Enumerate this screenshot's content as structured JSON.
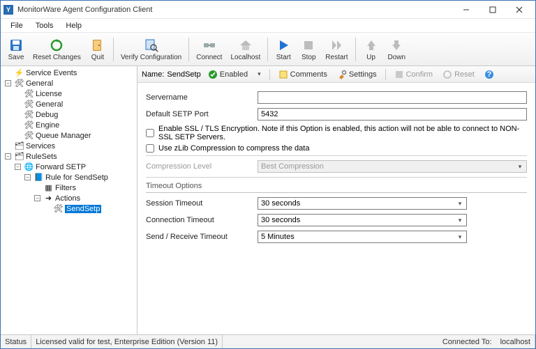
{
  "window": {
    "title": "MonitorWare Agent Configuration Client"
  },
  "menu": {
    "file": "File",
    "tools": "Tools",
    "help": "Help"
  },
  "toolbar": {
    "save": "Save",
    "reset": "Reset Changes",
    "quit": "Quit",
    "verify": "Verify Configuration",
    "connect": "Connect",
    "localhost": "Localhost",
    "start": "Start",
    "stop": "Stop",
    "restart": "Restart",
    "up": "Up",
    "down": "Down"
  },
  "tree": {
    "service_events": "Service Events",
    "general": "General",
    "license": "License",
    "general2": "General",
    "debug": "Debug",
    "engine": "Engine",
    "queue_manager": "Queue Manager",
    "services": "Services",
    "rulesets": "RuleSets",
    "forward_setp": "Forward SETP",
    "rule_for": "Rule for SendSetp",
    "filters": "Filters",
    "actions": "Actions",
    "sendsetp": "SendSetp"
  },
  "content_toolbar": {
    "name_label": "Name:",
    "name_value": "SendSetp",
    "enabled": "Enabled",
    "comments": "Comments",
    "settings": "Settings",
    "confirm": "Confirm",
    "reset": "Reset"
  },
  "form": {
    "servername_label": "Servername",
    "servername_value": "",
    "default_port_label": "Default SETP Port",
    "default_port_value": "5432",
    "enable_ssl": "Enable SSL / TLS Encryption. Note if this Option is enabled, this action will not be able to connect to NON-SSL SETP Servers.",
    "use_zlib": "Use zLib Compression to compress the data",
    "compression_label": "Compression Level",
    "compression_value": "Best Compression",
    "timeout_head": "Timeout Options",
    "session_timeout_label": "Session Timeout",
    "session_timeout_value": "30 seconds",
    "connection_timeout_label": "Connection Timeout",
    "connection_timeout_value": "30 seconds",
    "sendrecv_timeout_label": "Send / Receive Timeout",
    "sendrecv_timeout_value": "5 Minutes"
  },
  "status": {
    "left": "Status",
    "license": "Licensed valid for test, Enterprise Edition (Version 11)",
    "connected_label": "Connected To:",
    "connected_value": "localhost"
  }
}
